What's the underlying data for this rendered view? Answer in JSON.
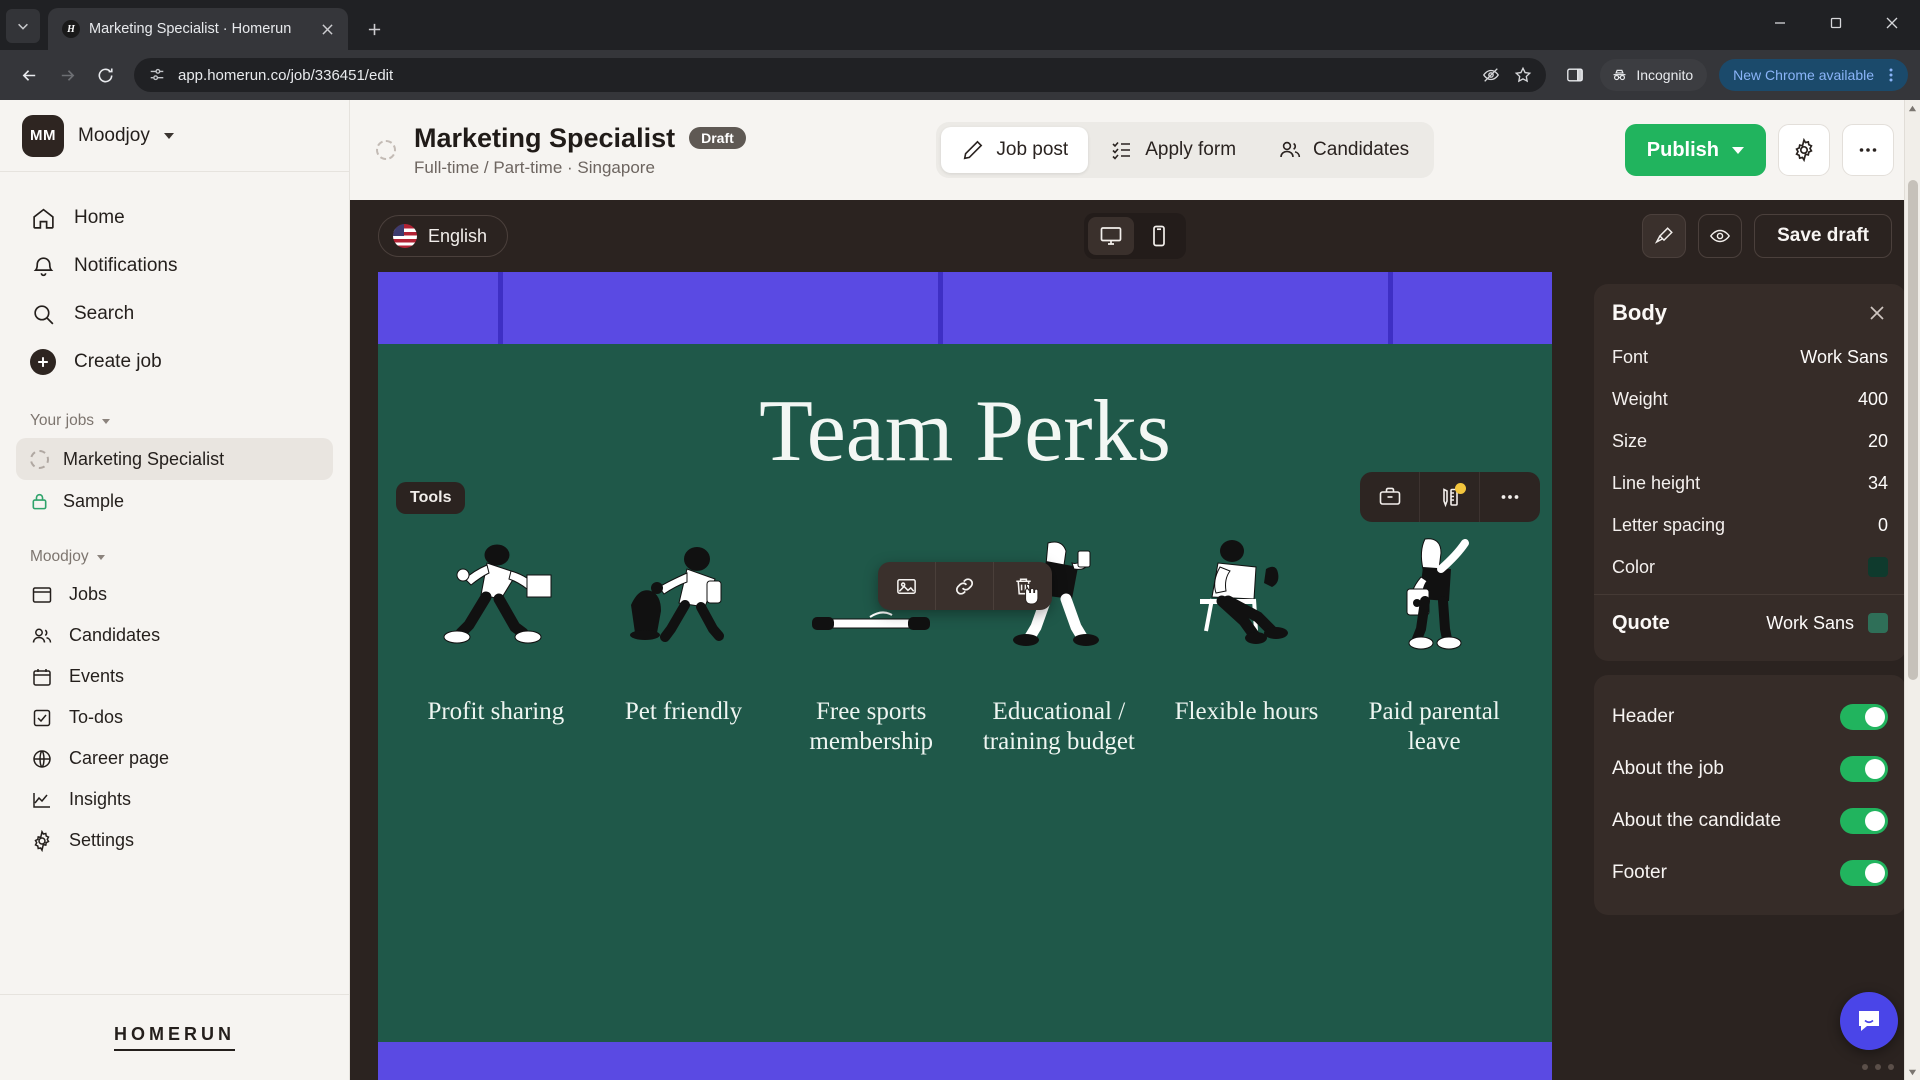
{
  "browser": {
    "tab": {
      "title": "Marketing Specialist · Homerun",
      "favicon_letter": "H"
    },
    "url": "app.homerun.co/job/336451/edit",
    "incognito_label": "Incognito",
    "update_label": "New Chrome available"
  },
  "sidebar": {
    "org": {
      "initials": "MM",
      "name": "Moodjoy"
    },
    "nav": [
      {
        "label": "Home",
        "icon": "home-icon"
      },
      {
        "label": "Notifications",
        "icon": "bell-icon"
      },
      {
        "label": "Search",
        "icon": "search-icon"
      },
      {
        "label": "Create job",
        "icon": "plus-circle-icon"
      }
    ],
    "your_jobs_label": "Your jobs",
    "jobs": [
      {
        "label": "Marketing Specialist",
        "icon": "dashed-circle-icon",
        "active": true
      },
      {
        "label": "Sample",
        "icon": "lock-icon",
        "active": false
      }
    ],
    "workspace_label": "Moodjoy",
    "workspace_items": [
      {
        "label": "Jobs",
        "icon": "board-icon"
      },
      {
        "label": "Candidates",
        "icon": "people-icon"
      },
      {
        "label": "Events",
        "icon": "calendar-icon"
      },
      {
        "label": "To-dos",
        "icon": "checkbox-icon"
      },
      {
        "label": "Career page",
        "icon": "globe-icon"
      },
      {
        "label": "Insights",
        "icon": "chart-line-icon"
      },
      {
        "label": "Settings",
        "icon": "gear-icon"
      }
    ],
    "logo_text": "HOMERUN"
  },
  "job_header": {
    "title": "Marketing Specialist",
    "status_badge": "Draft",
    "subtitle": "Full-time / Part-time · Singapore",
    "tabs": [
      {
        "label": "Job post",
        "icon": "pencil-icon",
        "active": true
      },
      {
        "label": "Apply form",
        "icon": "checklist-icon",
        "active": false
      },
      {
        "label": "Candidates",
        "icon": "people-icon",
        "active": false
      }
    ],
    "publish_label": "Publish",
    "settings_icon": "gear-icon",
    "more_icon": "ellipsis-icon"
  },
  "editor_toolbar": {
    "language": "English",
    "language_flag": "us-flag-icon",
    "devices": [
      {
        "name": "desktop-icon",
        "active": true
      },
      {
        "name": "mobile-icon",
        "active": false
      }
    ],
    "brush_icon": "paintbrush-icon",
    "preview_icon": "eye-icon",
    "save_draft_label": "Save draft"
  },
  "preview": {
    "tools_chip": "Tools",
    "section_title": "Team Perks",
    "perks": [
      {
        "label": "Profit sharing",
        "art": "person-running-with-briefcase"
      },
      {
        "label": "Pet friendly",
        "art": "person-with-dog"
      },
      {
        "label": "Free sports membership",
        "art": "person-exercising"
      },
      {
        "label": "Educational / training budget",
        "art": "person-walking-with-backpack"
      },
      {
        "label": "Flexible hours",
        "art": "person-sitting-on-chair"
      },
      {
        "label": "Paid parental leave",
        "art": "person-with-child"
      }
    ],
    "section_toolbar": [
      {
        "icon": "briefcase-icon",
        "badge": false
      },
      {
        "icon": "pencil-ruler-icon",
        "badge": true
      },
      {
        "icon": "ellipsis-icon",
        "badge": false
      }
    ],
    "inline_toolbar": [
      {
        "icon": "image-icon"
      },
      {
        "icon": "link-icon"
      },
      {
        "icon": "trash-icon"
      }
    ],
    "band_color": "#5a4ae3",
    "background_color": "#1f5849"
  },
  "right_panel": {
    "title": "Body",
    "close_icon": "close-icon",
    "properties": [
      {
        "label": "Font",
        "value": "Work Sans",
        "type": "text"
      },
      {
        "label": "Weight",
        "value": "400",
        "type": "text"
      },
      {
        "label": "Size",
        "value": "20",
        "type": "text"
      },
      {
        "label": "Line height",
        "value": "34",
        "type": "text"
      },
      {
        "label": "Letter spacing",
        "value": "0",
        "type": "text"
      },
      {
        "label": "Color",
        "value": "#0f3a2d",
        "type": "swatch"
      }
    ],
    "quote": {
      "label": "Quote",
      "font": "Work Sans",
      "color": "#2f6f58"
    },
    "toggles": [
      {
        "label": "Header",
        "on": true
      },
      {
        "label": "About the job",
        "on": true
      },
      {
        "label": "About the candidate",
        "on": true
      },
      {
        "label": "Footer",
        "on": true
      }
    ]
  },
  "chat": {
    "icon": "chat-bubble-icon",
    "color": "#4a45e8"
  }
}
